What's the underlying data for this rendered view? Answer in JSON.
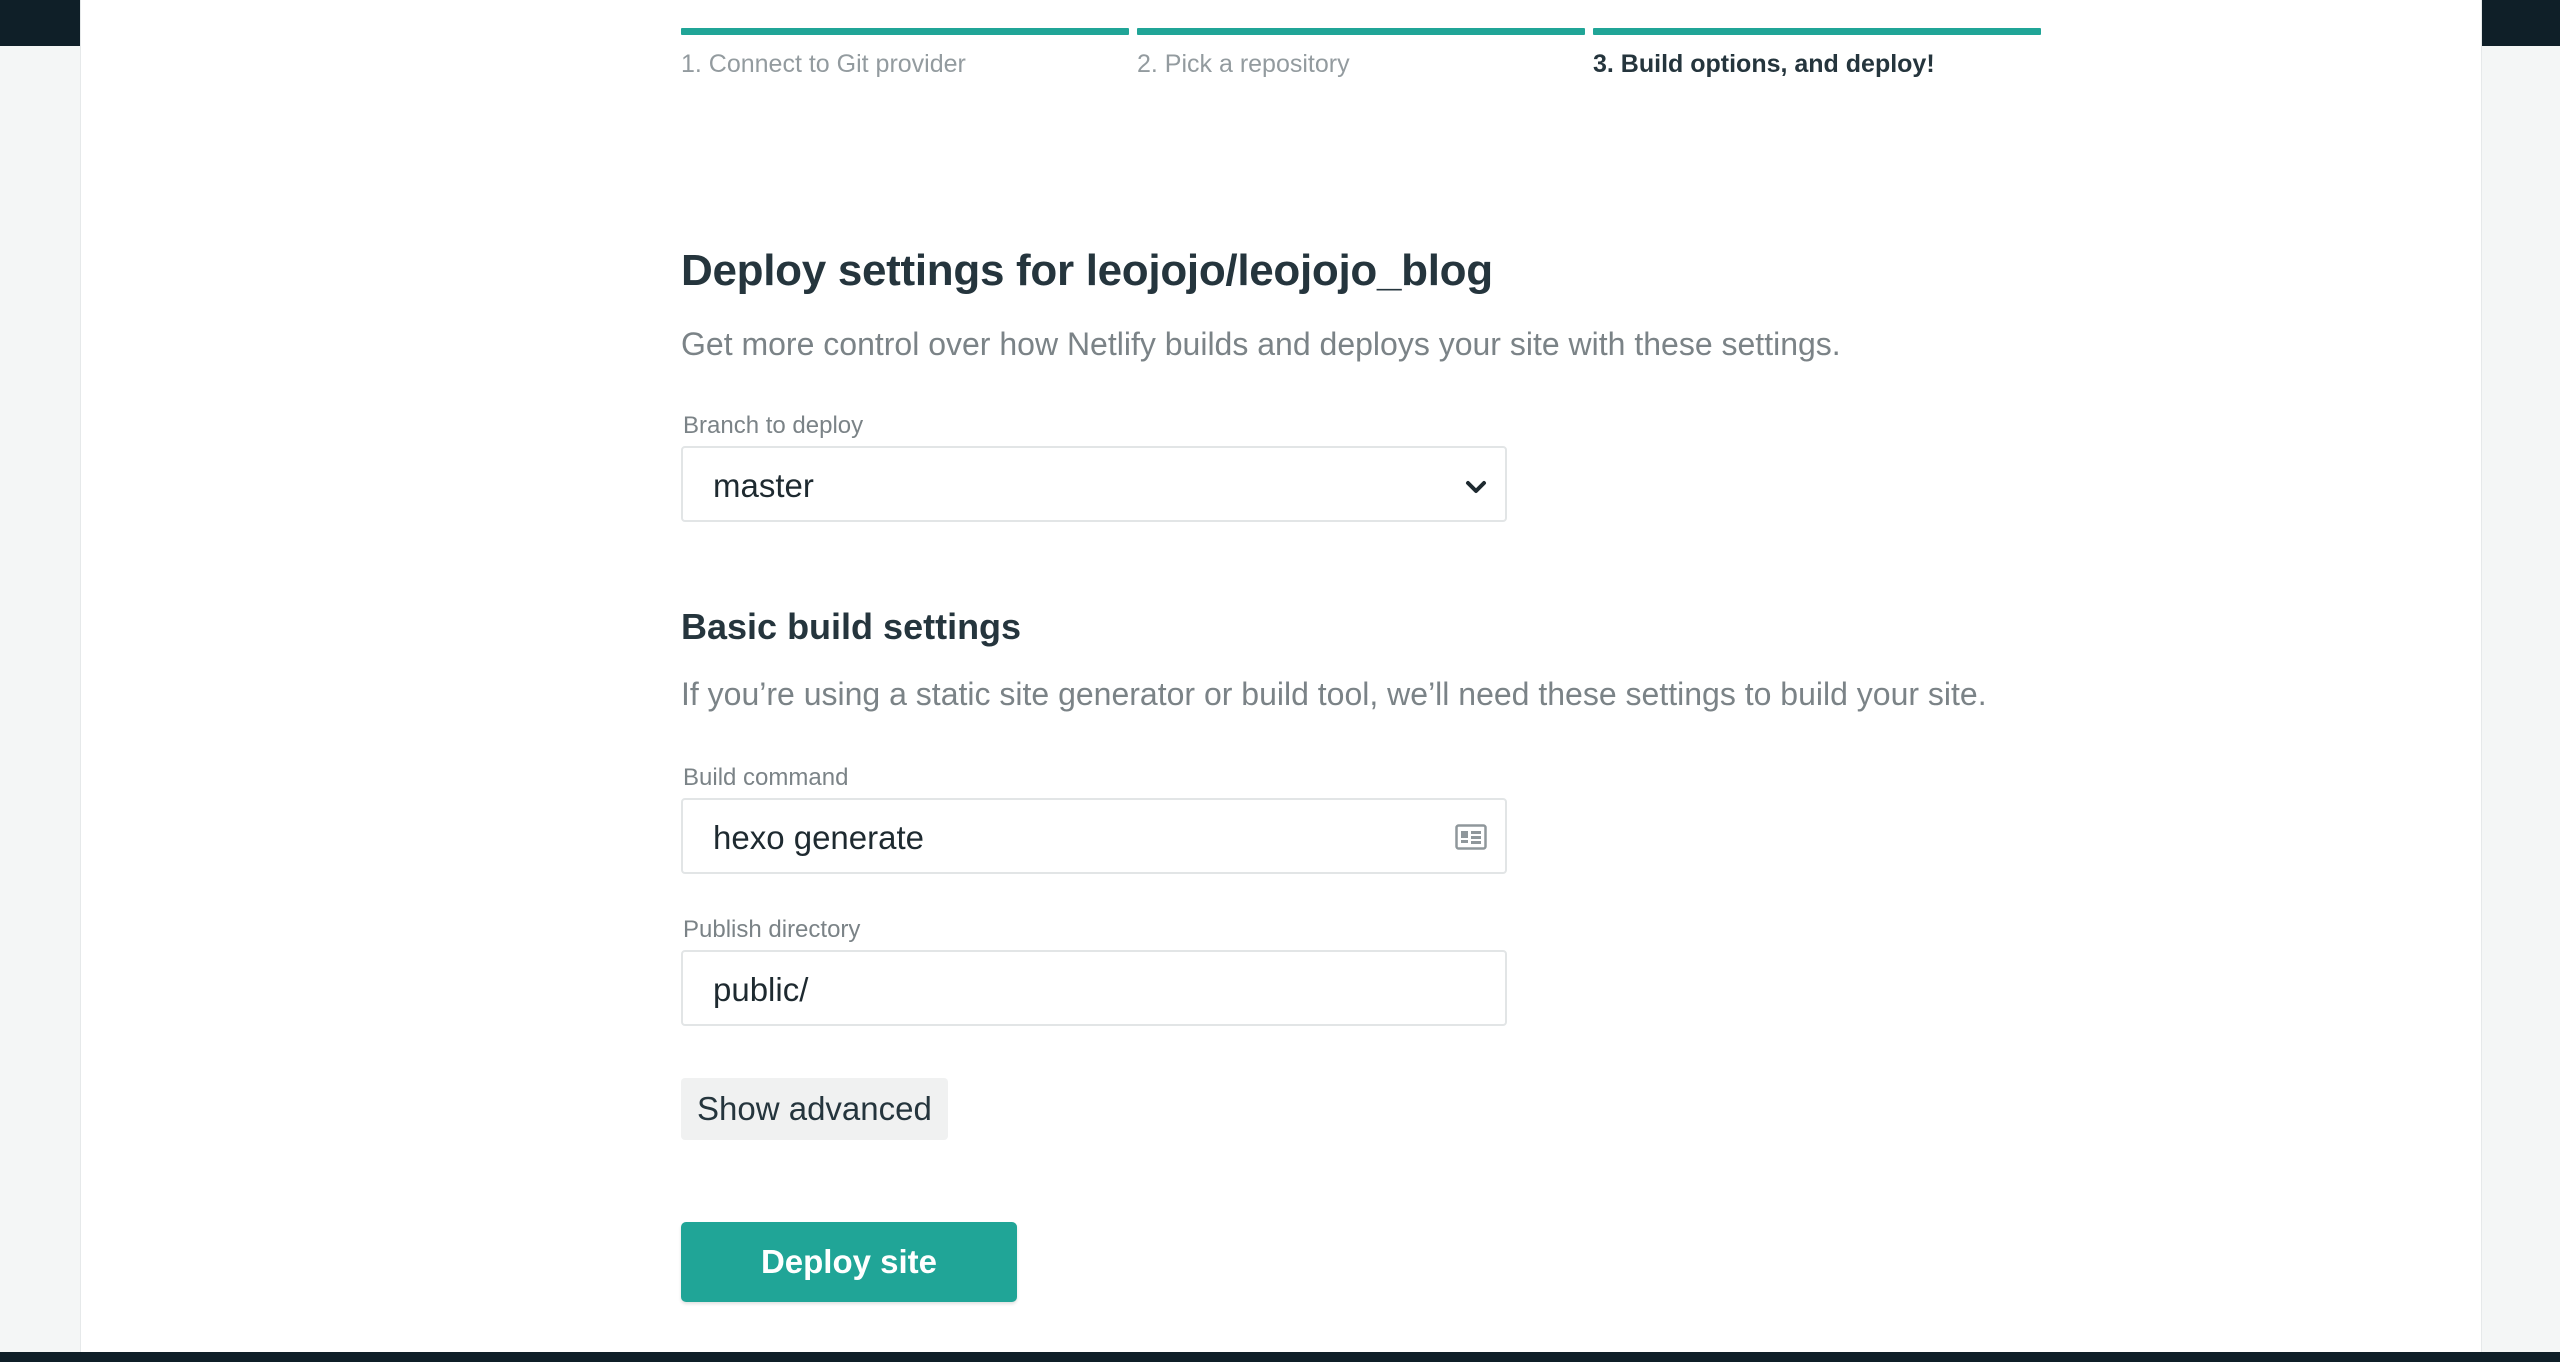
{
  "colors": {
    "accent": "#20a597",
    "heading": "#25353d",
    "muted": "#7b8387"
  },
  "steps": [
    {
      "label": "1. Connect to Git provider",
      "active": false
    },
    {
      "label": "2. Pick a repository",
      "active": false
    },
    {
      "label": "3. Build options, and deploy!",
      "active": true
    }
  ],
  "deploy": {
    "title": "Deploy settings for leojojo/leojojo_blog",
    "subtitle": "Get more control over how Netlify builds and deploys your site with these settings.",
    "branch_label": "Branch to deploy",
    "branch_value": "master",
    "branch_icon": "chevron-down-icon"
  },
  "build": {
    "title": "Basic build settings",
    "subtitle": "If you’re using a static site generator or build tool, we’ll need these settings to build your site.",
    "command_label": "Build command",
    "command_value": "hexo generate",
    "command_icon": "contact-card-icon",
    "publish_label": "Publish directory",
    "publish_value": "public/"
  },
  "actions": {
    "show_advanced": "Show advanced",
    "deploy_site": "Deploy site"
  }
}
